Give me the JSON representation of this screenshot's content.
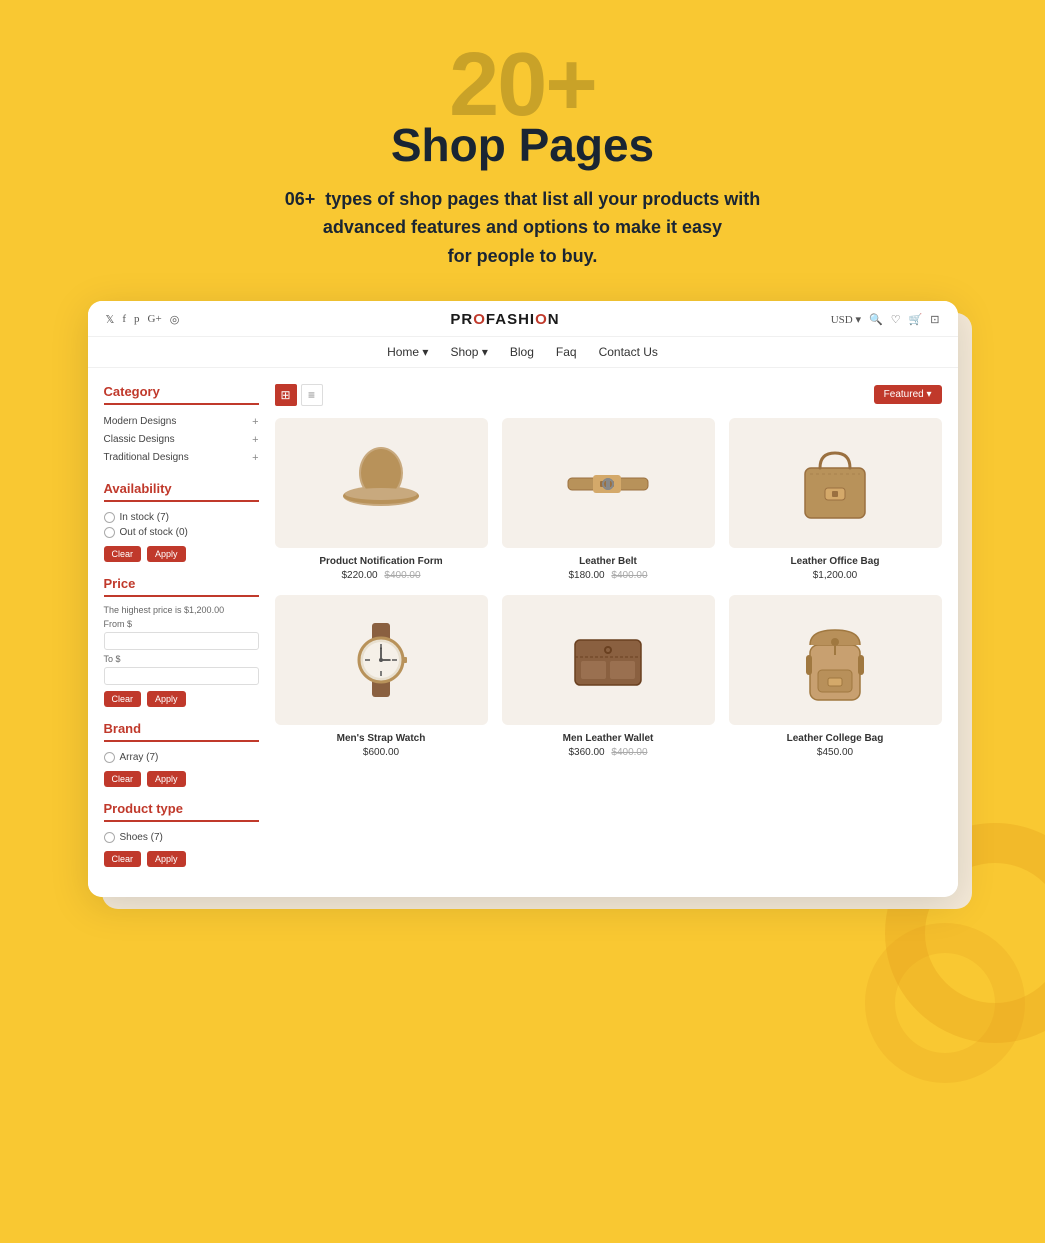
{
  "hero": {
    "number": "20+",
    "title": "Shop Pages",
    "description": "06+  types of shop pages that list all your products with\nadvanced features and options to make it easy\nfor people to buy."
  },
  "brand": {
    "name_part1": "PR",
    "name_highlight": "O",
    "name_part2": "FASHI",
    "name_highlight2": "O",
    "name_part3": "N",
    "full": "PROFASHION"
  },
  "navbar": {
    "items": [
      {
        "label": "Home",
        "has_arrow": true
      },
      {
        "label": "Shop",
        "has_arrow": true
      },
      {
        "label": "Blog",
        "has_arrow": false
      },
      {
        "label": "Faq",
        "has_arrow": false
      },
      {
        "label": "Contact Us",
        "has_arrow": false
      }
    ]
  },
  "social": [
    "t",
    "f",
    "p",
    "G+",
    "ig"
  ],
  "top_actions": [
    "USD ▾",
    "🔍",
    "♡",
    "🛒",
    "→"
  ],
  "sidebar": {
    "category": {
      "title": "Category",
      "items": [
        "Modern Designs",
        "Classic Designs",
        "Traditional Designs"
      ]
    },
    "availability": {
      "title": "Availability",
      "options": [
        {
          "label": "In stock (7)"
        },
        {
          "label": "Out of stock (0)"
        }
      ]
    },
    "price": {
      "title": "Price",
      "hint": "The highest price is $1,200.00",
      "from_label": "From $",
      "to_label": "To $"
    },
    "brand": {
      "title": "Brand",
      "options": [
        {
          "label": "Array (7)"
        }
      ]
    },
    "product_type": {
      "title": "Product type",
      "options": [
        {
          "label": "Shoes (7)"
        }
      ]
    }
  },
  "toolbar": {
    "sort_label": "Featured ▾"
  },
  "products": [
    {
      "name": "Product Notification Form",
      "price": "$220.00",
      "original_price": "$400.00",
      "type": "hat"
    },
    {
      "name": "Leather Belt",
      "price": "$180.00",
      "original_price": "$400.00",
      "type": "belt"
    },
    {
      "name": "Leather Office Bag",
      "price": "$1,200.00",
      "original_price": "",
      "type": "bag_office"
    },
    {
      "name": "Men's Strap Watch",
      "price": "$600.00",
      "original_price": "",
      "type": "watch"
    },
    {
      "name": "Men Leather Wallet",
      "price": "$360.00",
      "original_price": "$400.00",
      "type": "wallet"
    },
    {
      "name": "Leather College Bag",
      "price": "$450.00",
      "original_price": "",
      "type": "bag_college"
    }
  ]
}
